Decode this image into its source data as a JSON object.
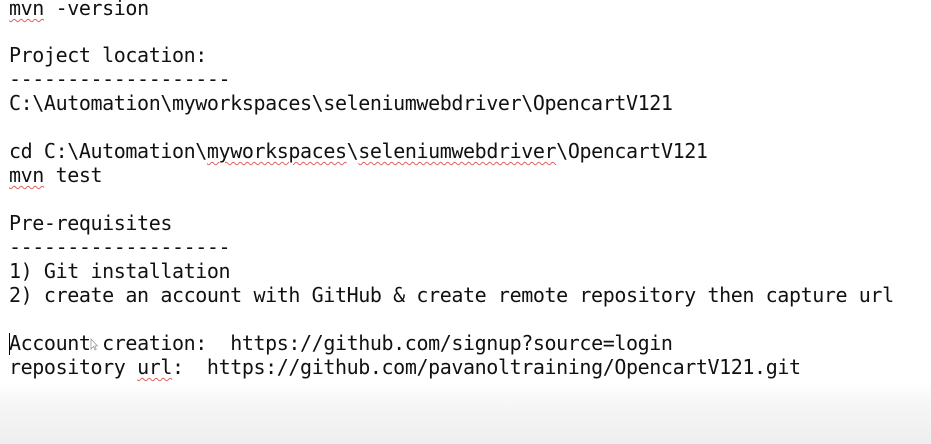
{
  "editor": {
    "line_1_command": "mvn",
    "line_1_rest": " -version",
    "project_location_heading": "Project location:",
    "separator_1": "-------------------",
    "project_path": "C:\\Automation\\myworkspaces\\seleniumwebdriver\\OpencartV121",
    "cd_prefix": "cd C:\\Automation\\",
    "cd_myworkspaces": "myworkspaces",
    "cd_sep_1": "\\",
    "cd_seleniumwebdriver": "seleniumwebdriver",
    "cd_suffix": "\\OpencartV121",
    "mvn_test_command": "mvn",
    "mvn_test_rest": " test",
    "prereq_heading": "Pre-requisites",
    "separator_2": "-------------------",
    "prereq_item_1": "1) Git installation",
    "prereq_item_2": "2) create an account with GitHub & create remote repository then capture url",
    "account_label_a": "Account",
    "account_label_b": " creation:  https://github.com/signup?source=login",
    "repo_label": "repository ",
    "repo_url_word": "url",
    "repo_rest": ":  https://github.com/pavanoltraining/OpencartV121.git"
  }
}
